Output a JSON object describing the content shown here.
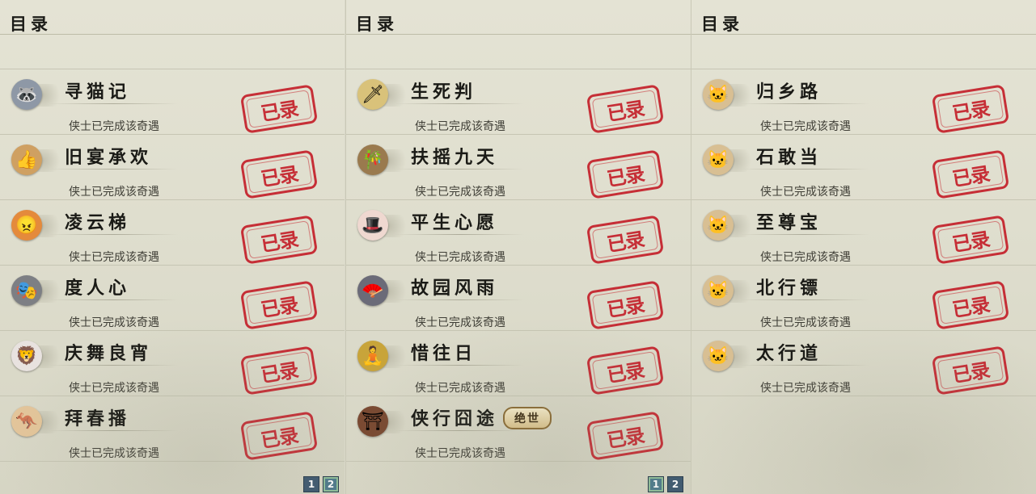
{
  "pages": [
    {
      "header": "目录",
      "entries": [
        {
          "title": "寻猫记",
          "status": "侠士已完成该奇遇",
          "stamp": "已录",
          "icon": "raccoon-icon",
          "icon_bg": "#8e98a6"
        },
        {
          "title": "旧宴承欢",
          "status": "侠士已完成该奇遇",
          "stamp": "已录",
          "icon": "thumbs-up-icon",
          "icon_bg": "#cfa062"
        },
        {
          "title": "凌云梯",
          "status": "侠士已完成该奇遇",
          "stamp": "已录",
          "icon": "angry-face-icon",
          "icon_bg": "#e48a3c"
        },
        {
          "title": "度人心",
          "status": "侠士已完成该奇遇",
          "stamp": "已录",
          "icon": "mask-icon",
          "icon_bg": "#7d7f84"
        },
        {
          "title": "庆舞良宵",
          "status": "侠士已完成该奇遇",
          "stamp": "已录",
          "icon": "lion-dance-icon",
          "icon_bg": "#e8e2df"
        },
        {
          "title": "拜春播",
          "status": "侠士已完成该奇遇",
          "stamp": "已录",
          "icon": "kangaroo-icon",
          "icon_bg": "#e3c59a"
        }
      ],
      "pager": {
        "pages": [
          "1",
          "2"
        ],
        "active": 1
      }
    },
    {
      "header": "目录",
      "entries": [
        {
          "title": "生死判",
          "status": "侠士已完成该奇遇",
          "stamp": "已录",
          "icon": "gold-ingot-icon",
          "icon_bg": "#d9c27a"
        },
        {
          "title": "扶摇九天",
          "status": "侠士已完成该奇遇",
          "stamp": "已录",
          "icon": "bamboo-icon",
          "icon_bg": "#9a7a4e"
        },
        {
          "title": "平生心愿",
          "status": "侠士已完成该奇遇",
          "stamp": "已录",
          "icon": "official-character-icon",
          "icon_bg": "#efd8d0"
        },
        {
          "title": "故园风雨",
          "status": "侠士已完成该奇遇",
          "stamp": "已录",
          "icon": "fan-icon",
          "icon_bg": "#6b6b78"
        },
        {
          "title": "惜往日",
          "status": "侠士已完成该奇遇",
          "stamp": "已录",
          "icon": "golden-buddha-icon",
          "icon_bg": "#c8a43a"
        },
        {
          "title": "侠行囧途",
          "status": "侠士已完成该奇遇",
          "stamp": "已录",
          "icon": "pavilion-icon",
          "icon_bg": "#7a4a32",
          "badge": "绝世"
        }
      ],
      "pager": {
        "pages": [
          "1",
          "2"
        ],
        "active": 0
      }
    },
    {
      "header": "目录",
      "entries": [
        {
          "title": "归乡路",
          "status": "侠士已完成该奇遇",
          "stamp": "已录",
          "icon": "cat-icon",
          "icon_bg": "#d8bf93"
        },
        {
          "title": "石敢当",
          "status": "侠士已完成该奇遇",
          "stamp": "已录",
          "icon": "cat-icon",
          "icon_bg": "#d8bf93"
        },
        {
          "title": "至尊宝",
          "status": "侠士已完成该奇遇",
          "stamp": "已录",
          "icon": "cat-icon",
          "icon_bg": "#d8bf93"
        },
        {
          "title": "北行镖",
          "status": "侠士已完成该奇遇",
          "stamp": "已录",
          "icon": "cat-icon",
          "icon_bg": "#d8bf93"
        },
        {
          "title": "太行道",
          "status": "侠士已完成该奇遇",
          "stamp": "已录",
          "icon": "cat-icon",
          "icon_bg": "#d8bf93"
        }
      ]
    }
  ],
  "colors": {
    "stamp_red": "#c4202a",
    "pager_blue": "#3d5870"
  }
}
